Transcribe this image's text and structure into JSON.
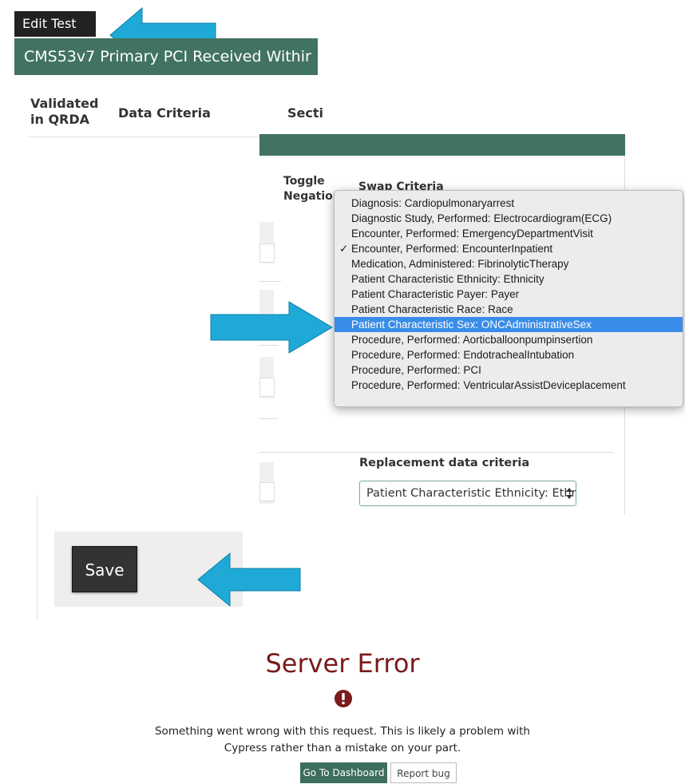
{
  "edit_test_label": "Edit Test",
  "title": "CMS53v7 Primary PCI Received Withir",
  "table_headers": {
    "validated": "Validated in QRDA",
    "data_criteria": "Data Criteria",
    "section": "Secti"
  },
  "toggle_negation": "Toggle Negation",
  "swap_criteria": "Swap Criteria",
  "dropdown": {
    "options": [
      {
        "label": "Diagnosis: Cardiopulmonaryarrest",
        "checked": false,
        "selected": false
      },
      {
        "label": "Diagnostic Study, Performed: Electrocardiogram(ECG)",
        "checked": false,
        "selected": false
      },
      {
        "label": "Encounter, Performed: EmergencyDepartmentVisit",
        "checked": false,
        "selected": false
      },
      {
        "label": "Encounter, Performed: EncounterInpatient",
        "checked": true,
        "selected": false
      },
      {
        "label": "Medication, Administered: FibrinolyticTherapy",
        "checked": false,
        "selected": false
      },
      {
        "label": "Patient Characteristic Ethnicity: Ethnicity",
        "checked": false,
        "selected": false
      },
      {
        "label": "Patient Characteristic Payer: Payer",
        "checked": false,
        "selected": false
      },
      {
        "label": "Patient Characteristic Race: Race",
        "checked": false,
        "selected": false
      },
      {
        "label": "Patient Characteristic Sex: ONCAdministrativeSex",
        "checked": false,
        "selected": true
      },
      {
        "label": "Procedure, Performed: Aorticballoonpumpinsertion",
        "checked": false,
        "selected": false
      },
      {
        "label": "Procedure, Performed: EndotrachealIntubation",
        "checked": false,
        "selected": false
      },
      {
        "label": "Procedure, Performed: PCI",
        "checked": false,
        "selected": false
      },
      {
        "label": "Procedure, Performed: VentricularAssistDeviceplacement",
        "checked": false,
        "selected": false
      }
    ],
    "check_glyph": "✓"
  },
  "replacement_label": "Replacement data criteria",
  "replacement_value": "Patient Characteristic Ethnicity: Ethr",
  "save_label": "Save",
  "error": {
    "title": "Server Error",
    "message_line1": "Something went wrong with this request. This is likely a problem with",
    "message_line2": "Cypress rather than a mistake on your part.",
    "dashboard_button": "Go To Dashboard",
    "report_button": "Report bug"
  },
  "colors": {
    "teal": "#417360",
    "arrow": "#1fa9d6",
    "highlight": "#3a8ce9",
    "error_red": "#7a1a1a"
  },
  "icons": [
    "arrow-right-icon",
    "arrow-left-icon",
    "exclamation-icon",
    "select-chevron-icon"
  ]
}
